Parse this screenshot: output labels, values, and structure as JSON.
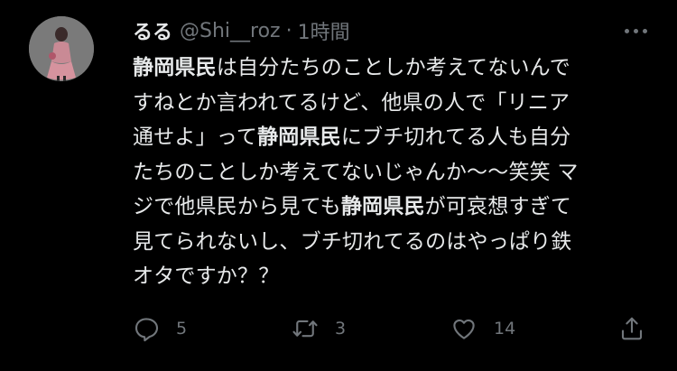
{
  "tweet": {
    "display_name": "るる",
    "handle": "@Shi__roz",
    "separator": "·",
    "time": "1時間",
    "body_lines": [
      [
        {
          "t": "静岡県民",
          "b": true
        },
        {
          "t": "は自分たちのことしか考えてないんで",
          "b": false
        }
      ],
      [
        {
          "t": "すねとか言われてるけど、他県の人で「リニア",
          "b": false
        }
      ],
      [
        {
          "t": "通せよ」って",
          "b": false
        },
        {
          "t": "静岡県民",
          "b": true
        },
        {
          "t": "にブチ切れてる人も自分",
          "b": false
        }
      ],
      [
        {
          "t": "たちのことしか考えてないじゃんか〜〜笑笑 マ",
          "b": false
        }
      ],
      [
        {
          "t": "ジで他県民から見ても",
          "b": false
        },
        {
          "t": "静岡県民",
          "b": true
        },
        {
          "t": "が可哀想すぎて",
          "b": false
        }
      ],
      [
        {
          "t": "見てられないし、ブチ切れてるのはやっぱり鉄",
          "b": false
        }
      ],
      [
        {
          "t": "オタですか？？",
          "b": false
        }
      ]
    ],
    "actions": {
      "reply_icon": "reply-icon",
      "reply_count": "5",
      "retweet_icon": "retweet-icon",
      "retweet_count": "3",
      "like_icon": "heart-icon",
      "like_count": "14",
      "share_icon": "share-icon"
    },
    "more_icon": "more-horizontal-icon"
  },
  "colors": {
    "background": "#000000",
    "primary_text": "#e7e9ea",
    "secondary_text": "#71767b"
  }
}
